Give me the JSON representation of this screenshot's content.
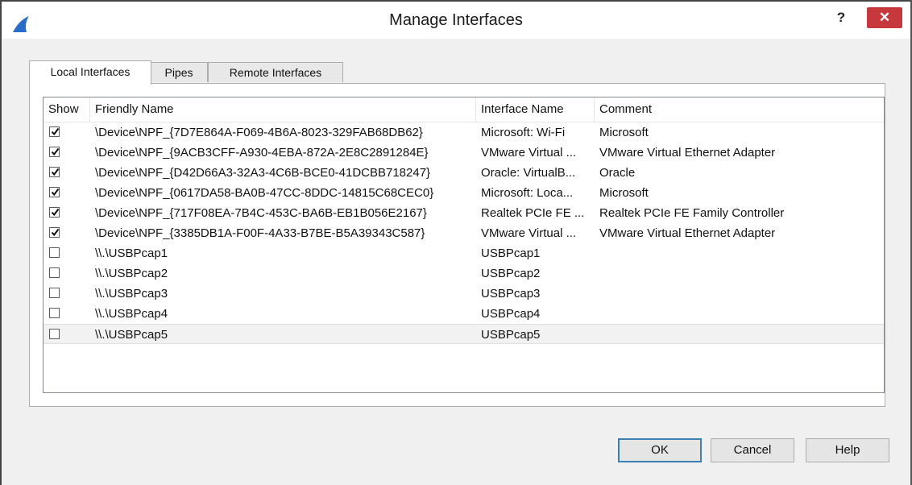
{
  "window": {
    "title": "Manage Interfaces",
    "help_label": "?",
    "close_label": "✕"
  },
  "tabs": [
    {
      "label": "Local Interfaces",
      "active": true
    },
    {
      "label": "Pipes",
      "active": false
    },
    {
      "label": "Remote Interfaces",
      "active": false
    }
  ],
  "table": {
    "columns": [
      "Show",
      "Friendly Name",
      "Interface Name",
      "Comment"
    ],
    "rows": [
      {
        "show": true,
        "friendly_name": "\\Device\\NPF_{7D7E864A-F069-4B6A-8023-329FAB68DB62}",
        "interface_name": "Microsoft: Wi-Fi",
        "comment": "Microsoft"
      },
      {
        "show": true,
        "friendly_name": "\\Device\\NPF_{9ACB3CFF-A930-4EBA-872A-2E8C2891284E}",
        "interface_name": "VMware Virtual ...",
        "comment": "VMware Virtual Ethernet Adapter"
      },
      {
        "show": true,
        "friendly_name": "\\Device\\NPF_{D42D66A3-32A3-4C6B-BCE0-41DCBB718247}",
        "interface_name": "Oracle: VirtualB...",
        "comment": "Oracle"
      },
      {
        "show": true,
        "friendly_name": "\\Device\\NPF_{0617DA58-BA0B-47CC-8DDC-14815C68CEC0}",
        "interface_name": "Microsoft: Loca...",
        "comment": "Microsoft"
      },
      {
        "show": true,
        "friendly_name": "\\Device\\NPF_{717F08EA-7B4C-453C-BA6B-EB1B056E2167}",
        "interface_name": "Realtek PCIe FE ...",
        "comment": "Realtek PCIe FE Family Controller"
      },
      {
        "show": true,
        "friendly_name": "\\Device\\NPF_{3385DB1A-F00F-4A33-B7BE-B5A39343C587}",
        "interface_name": "VMware Virtual ...",
        "comment": "VMware Virtual Ethernet Adapter"
      },
      {
        "show": false,
        "friendly_name": "\\\\.\\USBPcap1",
        "interface_name": "USBPcap1",
        "comment": ""
      },
      {
        "show": false,
        "friendly_name": "\\\\.\\USBPcap2",
        "interface_name": "USBPcap2",
        "comment": ""
      },
      {
        "show": false,
        "friendly_name": "\\\\.\\USBPcap3",
        "interface_name": "USBPcap3",
        "comment": ""
      },
      {
        "show": false,
        "friendly_name": "\\\\.\\USBPcap4",
        "interface_name": "USBPcap4",
        "comment": ""
      },
      {
        "show": false,
        "friendly_name": "\\\\.\\USBPcap5",
        "interface_name": "USBPcap5",
        "comment": "",
        "selected": true
      }
    ]
  },
  "buttons": {
    "ok": "OK",
    "cancel": "Cancel",
    "help": "Help"
  },
  "colors": {
    "close_button": "#c7383c",
    "app_icon": "#2a6cc9",
    "default_button_border": "#3c7fb1"
  },
  "icons": {
    "app": "wireshark-fin-icon",
    "checked": "checkmark-icon"
  }
}
